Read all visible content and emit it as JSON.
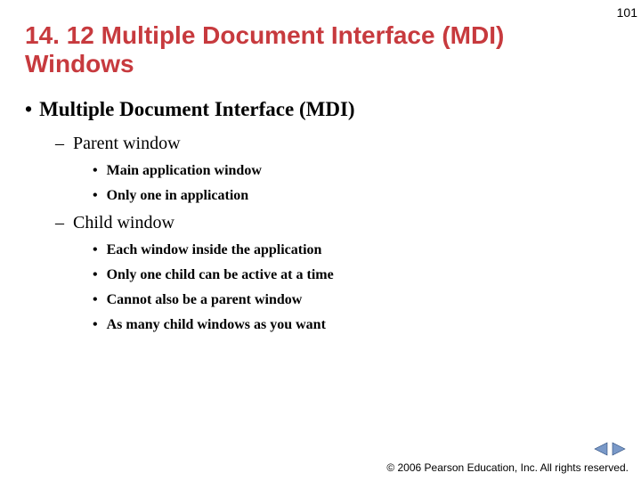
{
  "page_number": "101",
  "title": "14. 12 Multiple Document Interface (MDI) Windows",
  "content": {
    "heading": "Multiple Document Interface (MDI)",
    "sections": [
      {
        "label": "Parent window",
        "items": [
          "Main application window",
          "Only one in application"
        ]
      },
      {
        "label": "Child window",
        "items": [
          "Each window inside the application",
          "Only one child can be active at a time",
          "Cannot also be a parent window",
          "As many child windows as you want"
        ]
      }
    ]
  },
  "footer": {
    "copyright": "© 2006 Pearson Education, Inc.  All rights reserved."
  },
  "colors": {
    "title": "#c73a3e",
    "nav_prev": "#7a99c8",
    "nav_next": "#7a99c8"
  }
}
